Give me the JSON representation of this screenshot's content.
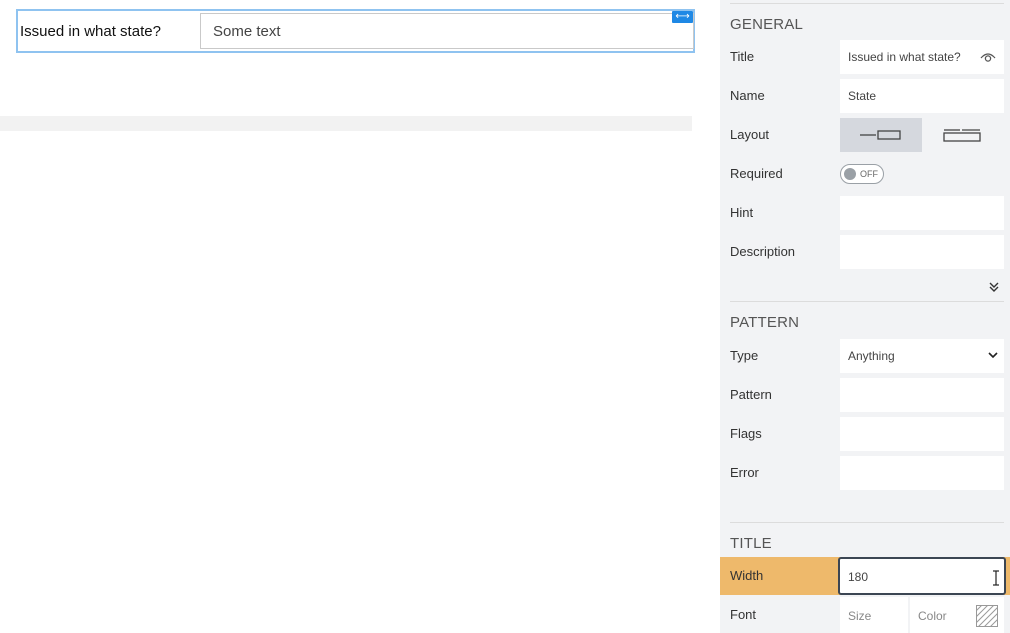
{
  "canvas": {
    "field_label": "Issued in what state?",
    "field_placeholder": "Some text",
    "resize_glyph": "⟷"
  },
  "panel": {
    "general": {
      "title": "GENERAL",
      "title_label": "Title",
      "title_value": "Issued in what state?",
      "name_label": "Name",
      "name_value": "State",
      "layout_label": "Layout",
      "required_label": "Required",
      "required_state": "OFF",
      "hint_label": "Hint",
      "hint_value": "",
      "description_label": "Description",
      "description_value": ""
    },
    "pattern": {
      "title": "PATTERN",
      "type_label": "Type",
      "type_value": "Anything",
      "pattern_label": "Pattern",
      "pattern_value": "",
      "flags_label": "Flags",
      "flags_value": "",
      "error_label": "Error",
      "error_value": ""
    },
    "title_section": {
      "title": "TITLE",
      "width_label": "Width",
      "width_value": "180",
      "font_label": "Font",
      "size_placeholder": "Size",
      "color_placeholder": "Color"
    }
  },
  "colors": {
    "accent_blue": "#1e88e5",
    "selection_border": "#8fc3f0",
    "highlight_row": "#eeb96b",
    "panel_bg": "#f2f3f5"
  },
  "icons": [
    "resize-horizontal-icon",
    "eye-icon",
    "layout-inline-icon",
    "layout-stacked-icon",
    "expand-chevrons-icon",
    "chevron-down-icon",
    "text-cursor-icon",
    "color-swatch-icon"
  ]
}
